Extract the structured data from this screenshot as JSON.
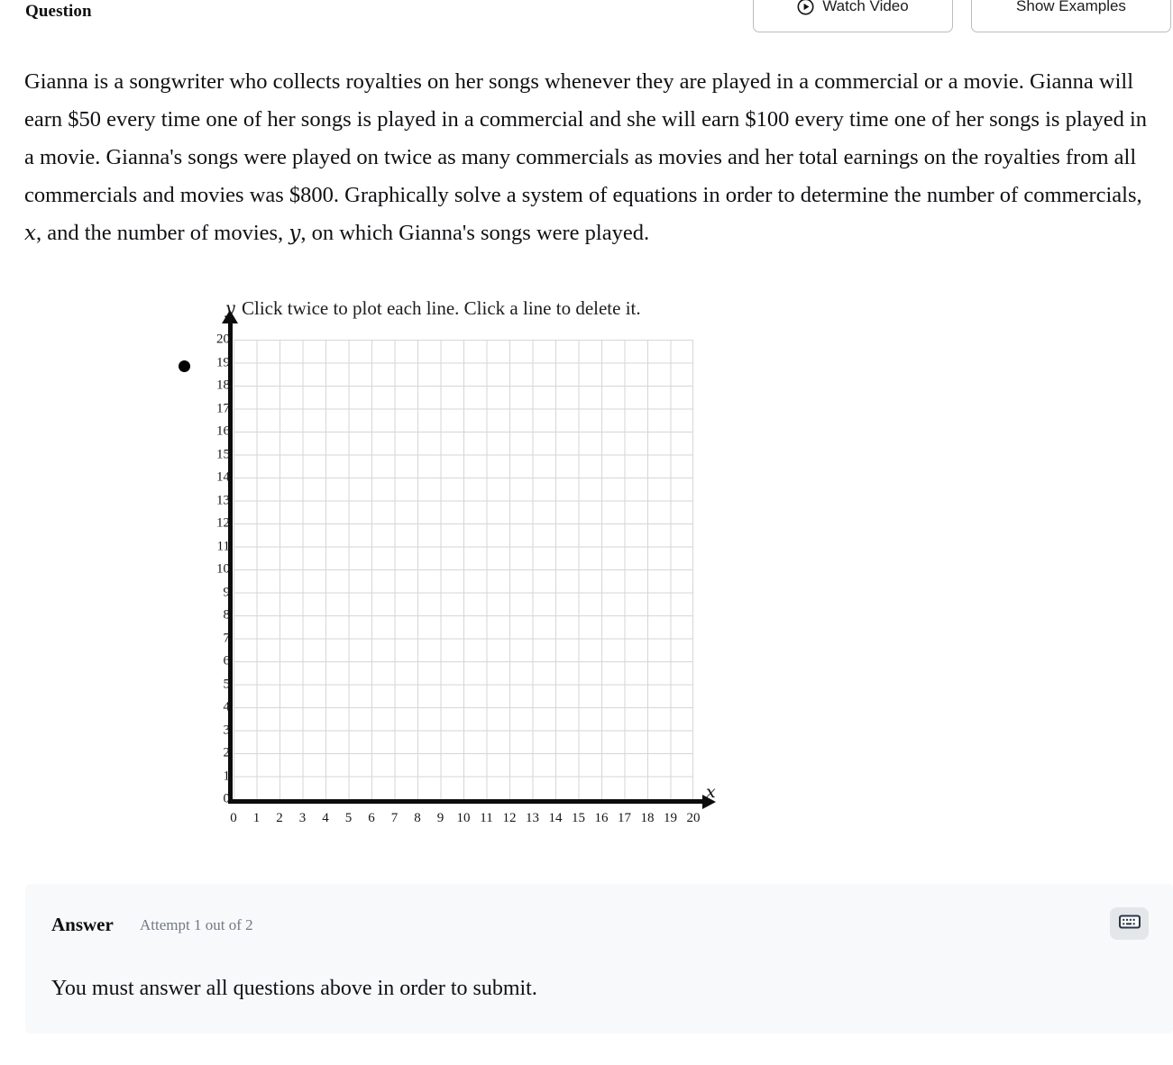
{
  "header": {
    "title": "Question",
    "watch_video_label": "Watch Video",
    "show_examples_label": "Show Examples",
    "play_icon": "play-circle-icon"
  },
  "question": {
    "part1": "Gianna is a songwriter who collects royalties on her songs whenever they are played in a commercial or a movie. Gianna will earn $50 every time one of her songs is played in a commercial and she will earn $100 every time one of her songs is played in a movie. Gianna's songs were played on twice as many commercials as movies and her total earnings on the royalties from all commercials and movies was $800. Graphically solve a system of equations in order to determine the number of commercials, ",
    "var_x": "x",
    "part2": ", and the number of movies, ",
    "var_y": "y",
    "part3": ", on which Gianna's songs were played."
  },
  "graph": {
    "instructions": "Click twice to plot each line. Click a line to delete it.",
    "y_axis_label": "y",
    "x_axis_label": "x",
    "bullet": "bullet-marker"
  },
  "chart_data": {
    "type": "line",
    "title": "",
    "xlabel": "x",
    "ylabel": "y",
    "xlim": [
      0,
      20
    ],
    "ylim": [
      0,
      20
    ],
    "xticks": [
      0,
      1,
      2,
      3,
      4,
      5,
      6,
      7,
      8,
      9,
      10,
      11,
      12,
      13,
      14,
      15,
      16,
      17,
      18,
      19,
      20
    ],
    "yticks": [
      0,
      1,
      2,
      3,
      4,
      5,
      6,
      7,
      8,
      9,
      10,
      11,
      12,
      13,
      14,
      15,
      16,
      17,
      18,
      19,
      20
    ],
    "xtick_labels": [
      "0",
      "1",
      "2",
      "3",
      "4",
      "5",
      "6",
      "7",
      "8",
      "9",
      "10",
      "11",
      "12",
      "13",
      "14",
      "15",
      "16",
      "17",
      "18",
      "19",
      "20"
    ],
    "ytick_labels": [
      "0",
      "1",
      "2",
      "3",
      "4",
      "5",
      "6",
      "7",
      "8",
      "9",
      "10",
      "11",
      "12",
      "13",
      "14",
      "15",
      "16",
      "17",
      "18",
      "19",
      "20"
    ],
    "grid": true,
    "legend": false,
    "series": [],
    "annotations": [
      "Click twice to plot each line. Click a line to delete it."
    ]
  },
  "answer": {
    "title": "Answer",
    "attempt_label": "Attempt 1 out of 2",
    "keyboard_icon": "keyboard-icon",
    "submit_warning": "You must answer all questions above in order to submit."
  },
  "colors": {
    "panel_bg": "#f7f9fb",
    "axis": "#0c0c0c",
    "grid": "#d6d6d8",
    "muted_text": "#737884",
    "keyboard_button_bg": "#e4e7ea"
  }
}
